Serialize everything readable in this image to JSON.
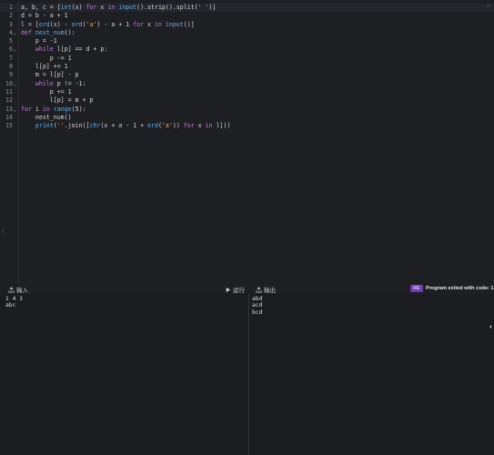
{
  "editor": {
    "lines": [
      {
        "n": "1",
        "fold": "",
        "html": "a, b, c = [<span class='fn'>int</span>(x) <span class='kw'>for</span> x <span class='kw'>in</span> <span class='fn'>input</span>().strip().split(<span class='str'>' '</span>)]"
      },
      {
        "n": "2",
        "fold": "",
        "html": "d = b - a + 1"
      },
      {
        "n": "3",
        "fold": "",
        "html": "l = [<span class='fn'>ord</span>(x) - <span class='fn'>ord</span>(<span class='str'>'a'</span>) - a + 1 <span class='kw'>for</span> x <span class='kw'>in</span> <span class='fn'>input</span>()]"
      },
      {
        "n": "4",
        "fold": "⌄",
        "html": "<span class='kw'>def</span> <span class='fn'>next_num</span>():"
      },
      {
        "n": "5",
        "fold": "",
        "html": "    p = -1"
      },
      {
        "n": "6",
        "fold": "⌄",
        "html": "    <span class='kw'>while</span> l[p] == d + p:"
      },
      {
        "n": "7",
        "fold": "",
        "html": "        p -= 1"
      },
      {
        "n": "8",
        "fold": "",
        "html": "    l[p] += 1"
      },
      {
        "n": "9",
        "fold": "",
        "html": "    m = l[p] - p"
      },
      {
        "n": "10",
        "fold": "⌄",
        "html": "    <span class='kw'>while</span> p != -1:"
      },
      {
        "n": "11",
        "fold": "",
        "html": "        p += 1"
      },
      {
        "n": "12",
        "fold": "",
        "html": "        l[p] = m + p"
      },
      {
        "n": "13",
        "fold": "⌄",
        "html": "<span class='kw'>for</span> i <span class='kw'>in</span> <span class='fn'>range</span>(5):"
      },
      {
        "n": "14",
        "fold": "",
        "html": "    next_num()"
      },
      {
        "n": "15",
        "fold": "",
        "html": "    <span class='fn'>print</span>(<span class='str'>''</span>.join([<span class='fn'>chr</span>(x + a - 1 + <span class='fn'>ord</span>(<span class='str'>'a'</span>)) <span class='kw'>for</span> x <span class='kw'>in</span> l]))"
      }
    ]
  },
  "toolbar": {
    "input_label": "输入",
    "run_label": "运行",
    "output_label": "输出",
    "badge": "RE",
    "status": "Program exited with code: 1"
  },
  "input_pane": {
    "text": "1 4 3\nabc"
  },
  "output_pane": {
    "text": "abd\nacd\nbcd"
  },
  "colors": {
    "accent": "#6e3cb8",
    "keyword": "#c678dd",
    "function": "#61afef",
    "string": "#e0b060"
  }
}
